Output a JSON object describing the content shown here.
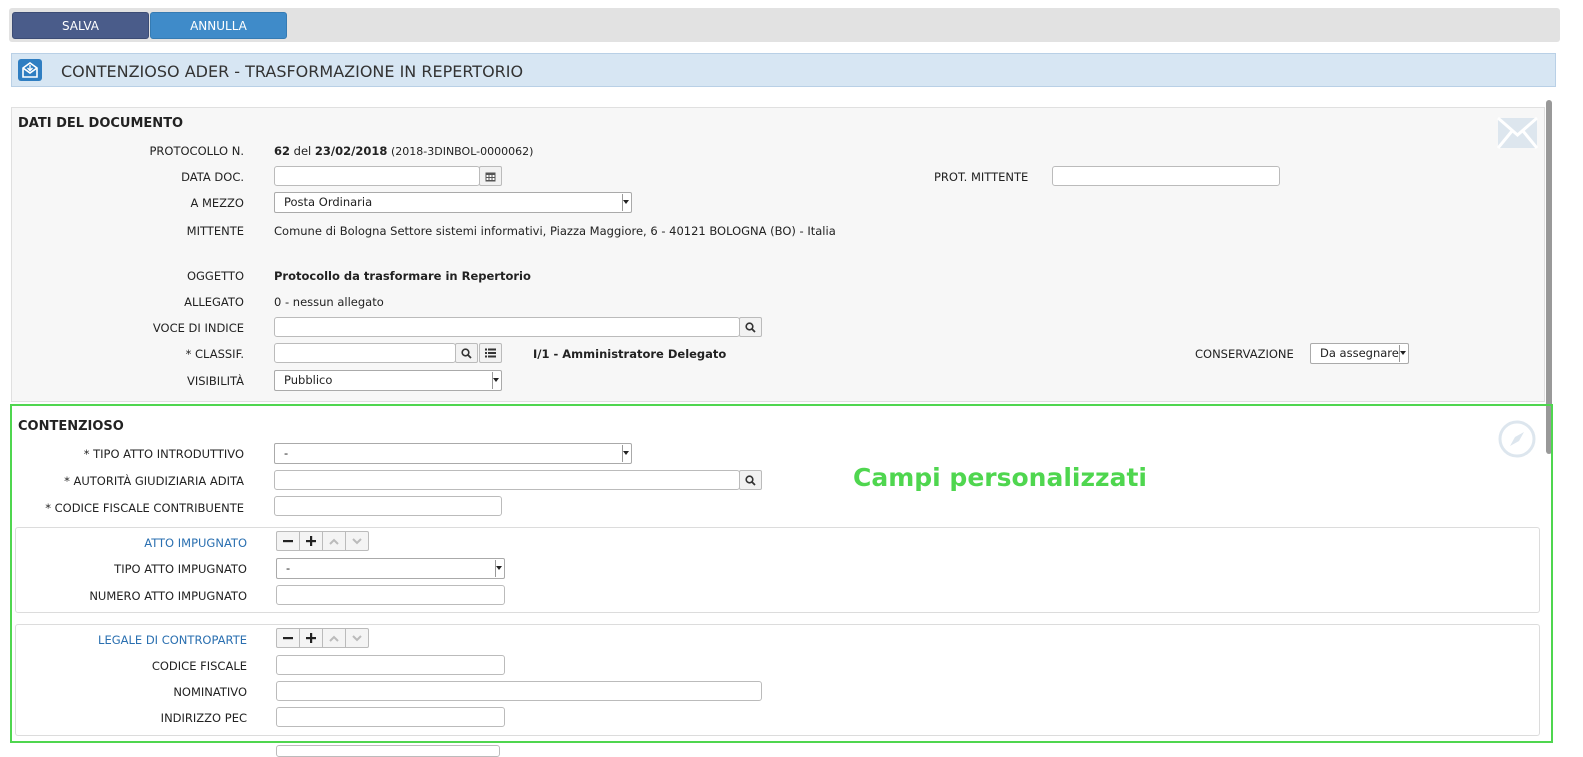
{
  "toolbar": {
    "save_label": "SALVA",
    "cancel_label": "ANNULLA"
  },
  "header": {
    "title": "CONTENZIOSO ADER - TRASFORMAZIONE IN REPERTORIO"
  },
  "dati_documento": {
    "section_title": "DATI DEL DOCUMENTO",
    "protocollo": {
      "label": "PROTOCOLLO N.",
      "numero": "62",
      "del": "del",
      "data": "23/02/2018",
      "codice": "(2018-3DINBOL-0000062)"
    },
    "data_doc": {
      "label": "DATA DOC.",
      "value": ""
    },
    "prot_mittente": {
      "label": "PROT. MITTENTE",
      "value": ""
    },
    "a_mezzo": {
      "label": "A MEZZO",
      "value": "Posta Ordinaria"
    },
    "mittente": {
      "label": "MITTENTE",
      "value": "Comune di Bologna Settore sistemi informativi, Piazza Maggiore, 6 - 40121 BOLOGNA (BO) - Italia"
    },
    "oggetto": {
      "label": "OGGETTO",
      "value": "Protocollo da trasformare in Repertorio"
    },
    "allegato": {
      "label": "ALLEGATO",
      "value": "0 - nessun allegato"
    },
    "voce_indice": {
      "label": "VOCE DI INDICE",
      "value": ""
    },
    "classif": {
      "label": "* CLASSIF.",
      "value": "",
      "desc": "I/1 - Amministratore Delegato"
    },
    "conservazione": {
      "label": "CONSERVAZIONE",
      "value": "Da assegnare"
    },
    "visibilita": {
      "label": "VISIBILITÀ",
      "value": "Pubblico"
    }
  },
  "contenzioso": {
    "section_title": "CONTENZIOSO",
    "tipo_atto_introduttivo": {
      "label": "* TIPO ATTO INTRODUTTIVO",
      "value": "-"
    },
    "autorita": {
      "label": "* AUTORITÀ GIUDIZIARIA ADITA",
      "value": ""
    },
    "codice_fiscale_contribuente": {
      "label": "* CODICE FISCALE CONTRIBUENTE",
      "value": ""
    },
    "annotation": "Campi personalizzati",
    "atto_impugnato": {
      "label": "ATTO IMPUGNATO",
      "tipo": {
        "label": "TIPO ATTO IMPUGNATO",
        "value": "-"
      },
      "numero": {
        "label": "NUMERO ATTO IMPUGNATO",
        "value": ""
      }
    },
    "legale": {
      "label": "LEGALE DI CONTROPARTE",
      "codice_fiscale": {
        "label": "CODICE FISCALE",
        "value": ""
      },
      "nominativo": {
        "label": "NOMINATIVO",
        "value": ""
      },
      "indirizzo_pec": {
        "label": "INDIRIZZO PEC",
        "value": ""
      }
    }
  },
  "colors": {
    "annotation": "#4fd64f",
    "accent": "#3f8bc9",
    "save": "#4a5c8a"
  }
}
